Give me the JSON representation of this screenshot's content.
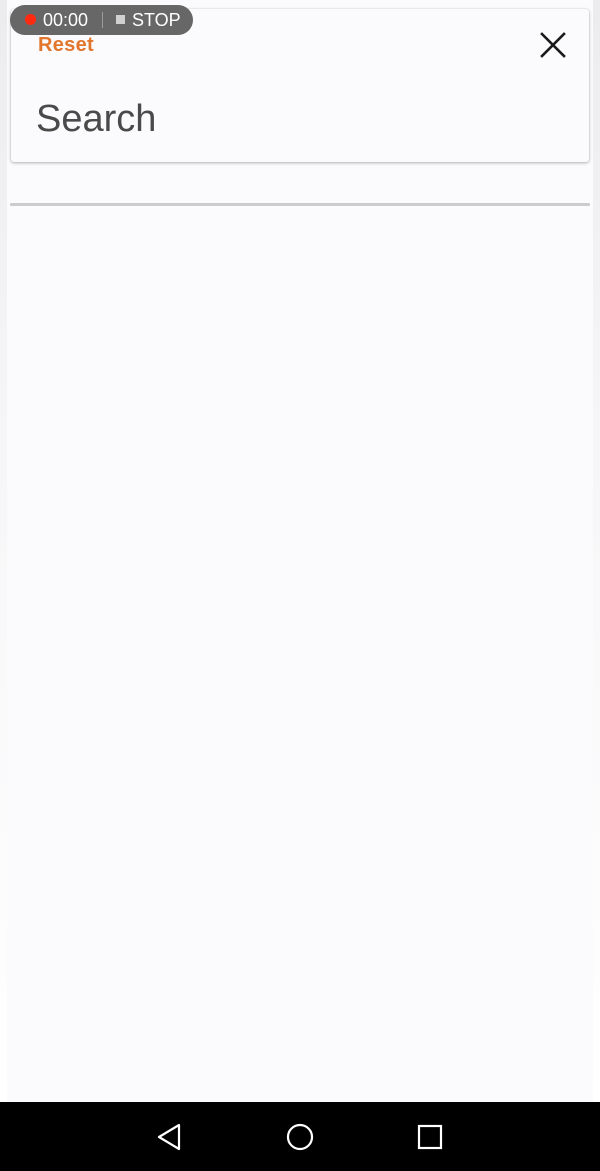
{
  "recorder": {
    "time": "00:00",
    "stop_label": "STOP",
    "dot_color": "#ff2a10"
  },
  "search_panel": {
    "reset_label": "Reset",
    "reset_color": "#e2762d",
    "close_icon": "close-icon",
    "search_placeholder": "Search",
    "search_value": ""
  },
  "navigation_bar": {
    "back_icon": "back-triangle-icon",
    "home_icon": "home-circle-icon",
    "recents_icon": "recents-square-icon"
  }
}
